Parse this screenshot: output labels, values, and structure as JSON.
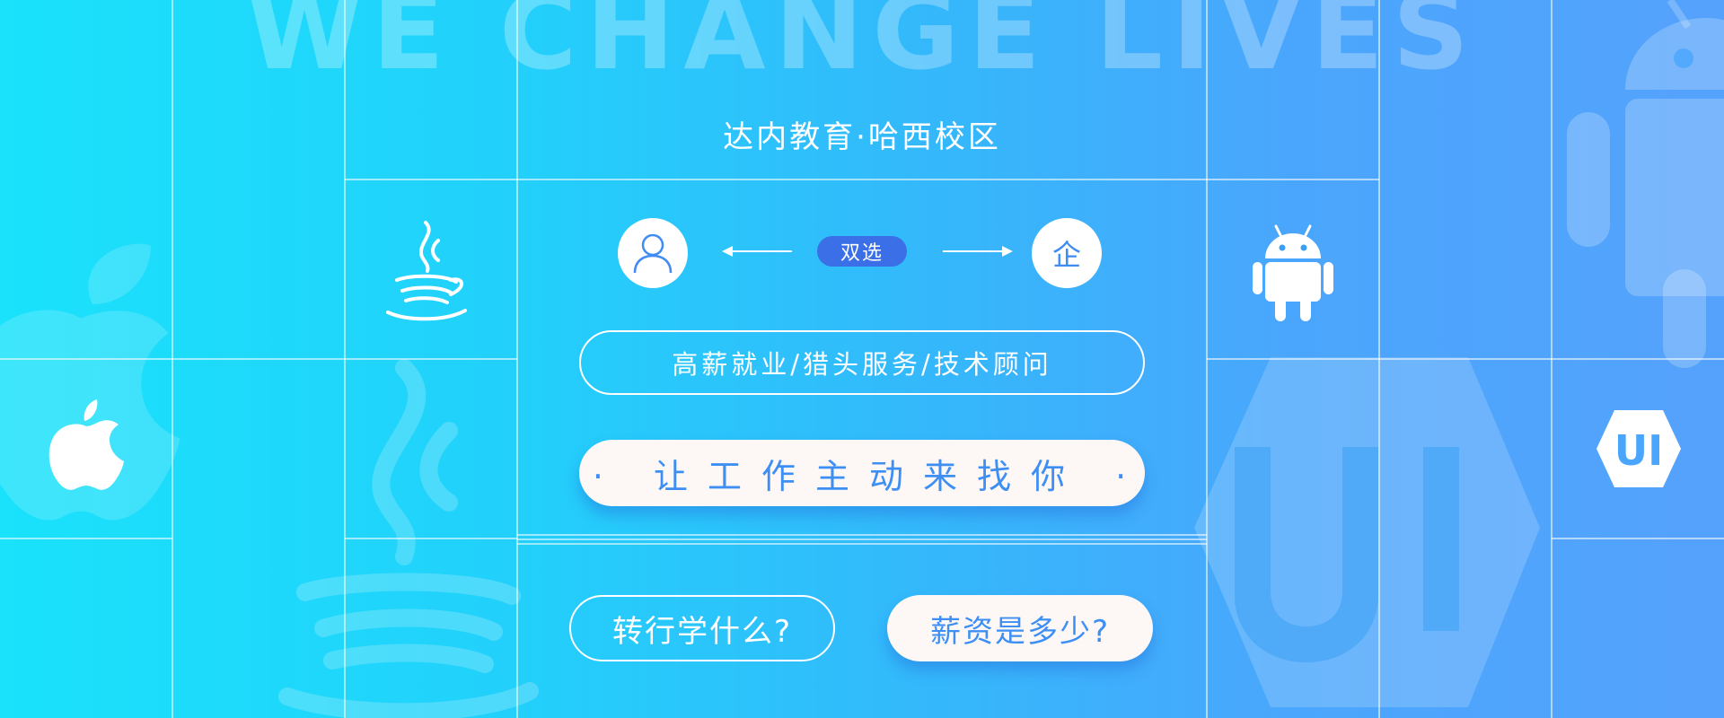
{
  "background_slogan": "WE CHANGE LIVES",
  "campus_title": "达内教育·哈西校区",
  "dual_select": {
    "badge": "双选",
    "company_char": "企"
  },
  "services_label": "高薪就业/猎头服务/技术顾问",
  "main_slogan": "· 让工作主动来找你 ·",
  "buttons": {
    "career_change": "转行学什么?",
    "salary": "薪资是多少?"
  },
  "ui_badge_text": "UI",
  "colors": {
    "gradient_start": "#1ae2fb",
    "gradient_end": "#55a2fc",
    "accent_blue": "#3e8ff4",
    "badge_blue": "#3a6fe8",
    "pill_fill": "#fdf8f6",
    "line_white": "#ffffff"
  },
  "icons": [
    "apple-icon",
    "java-icon",
    "android-icon",
    "ui-hexagon-icon",
    "person-icon"
  ]
}
